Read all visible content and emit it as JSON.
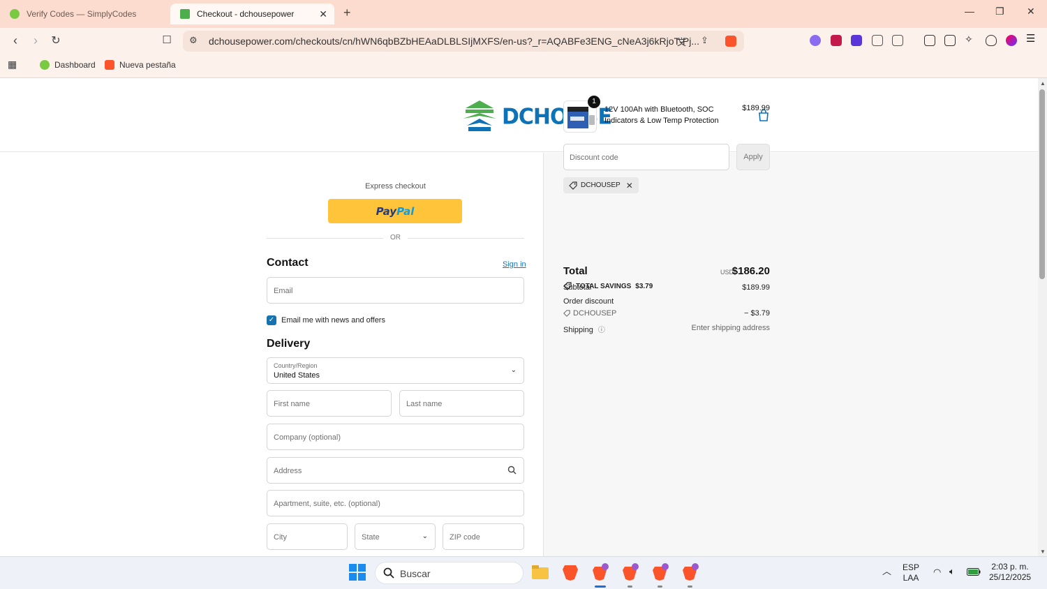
{
  "browser": {
    "tabs": [
      {
        "title": "Verify Codes — SimplyCodes",
        "active": false
      },
      {
        "title": "Checkout - dchousepower",
        "active": true
      }
    ],
    "url": "dchousepower.com/checkouts/cn/hWN6qbBZbHEAaDLBLSIjMXFS/en-us?_r=AQABFe3ENG_cNeA3j6kRjoT-Pj...",
    "bookmarks": [
      "Dashboard",
      "Nueva pestaña"
    ]
  },
  "site": {
    "logo_text": "DCHOUSE",
    "brand_color": "#0e72b7"
  },
  "express": {
    "label": "Express checkout",
    "paypal_a": "Pay",
    "paypal_b": "Pal",
    "or": "OR"
  },
  "contact": {
    "title": "Contact",
    "sign_in": "Sign in",
    "email_placeholder": "Email",
    "newsletter_label": "Email me with news and offers",
    "newsletter_checked": true
  },
  "delivery": {
    "title": "Delivery",
    "country_label": "Country/Region",
    "country_value": "United States",
    "first_name": "First name",
    "last_name": "Last name",
    "company": "Company (optional)",
    "address": "Address",
    "apartment": "Apartment, suite, etc. (optional)",
    "city": "City",
    "state": "State",
    "zip": "ZIP code"
  },
  "summary": {
    "product_title": "12V 100Ah with Bluetooth, SOC Indicators & Low Temp Protection",
    "product_price": "$189.99",
    "quantity": "1",
    "discount_placeholder": "Discount code",
    "apply": "Apply",
    "applied_code": "DCHOUSEP",
    "subtotal_label": "Subtotal",
    "subtotal_value": "$189.99",
    "order_discount_label": "Order discount",
    "discount_code": "DCHOUSEP",
    "discount_value": "− $3.79",
    "shipping_label": "Shipping",
    "shipping_value": "Enter shipping address",
    "total_label": "Total",
    "currency": "USD",
    "total_value": "$186.20",
    "savings_label": "TOTAL SAVINGS",
    "savings_value": "$3.79"
  },
  "taskbar": {
    "search_placeholder": "Buscar",
    "lang_top": "ESP",
    "lang_bottom": "LAA",
    "time": "2:03 p. m.",
    "date": "25/12/2025"
  }
}
